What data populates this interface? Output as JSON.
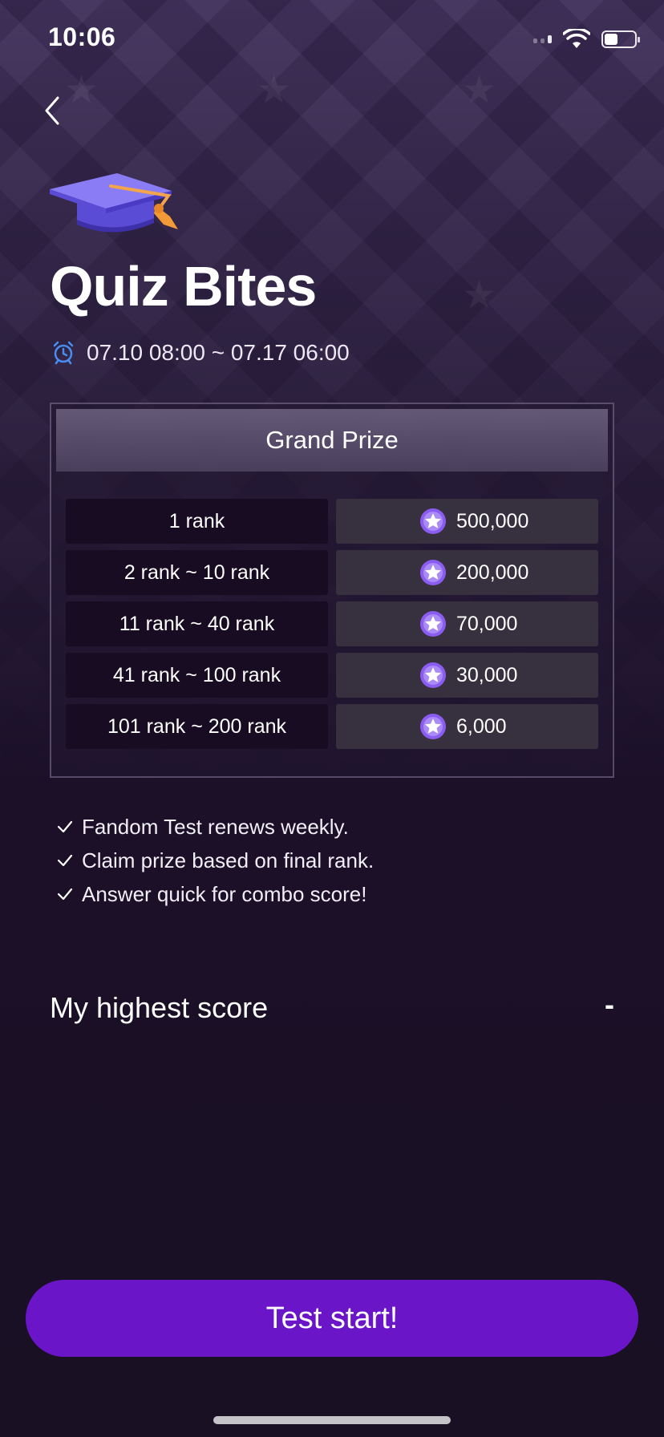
{
  "status_bar": {
    "time": "10:06",
    "battery_level": 0.45
  },
  "header": {
    "back_icon": "chevron-left-icon"
  },
  "quiz": {
    "title": "Quiz Bites",
    "period": "07.10 08:00 ~ 07.17 06:00",
    "period_icon": "alarm-clock-icon",
    "hero_icon": "graduation-cap-icon"
  },
  "prize": {
    "header": "Grand Prize",
    "coin_icon": "star-coin-icon",
    "rows": [
      {
        "rank": "1 rank",
        "reward": "500,000"
      },
      {
        "rank": "2 rank ~  10 rank",
        "reward": "200,000"
      },
      {
        "rank": "11 rank ~  40 rank",
        "reward": "70,000"
      },
      {
        "rank": "41 rank ~  100 rank",
        "reward": "30,000"
      },
      {
        "rank": "101 rank ~  200 rank",
        "reward": "6,000"
      }
    ]
  },
  "notes": [
    "Fandom Test renews weekly.",
    "Claim prize based on final rank.",
    "Answer quick for combo score!"
  ],
  "score": {
    "label": "My highest score",
    "value": "-"
  },
  "cta": {
    "label": "Test start!"
  },
  "colors": {
    "accent": "#6b15c8",
    "clock": "#4a8cf0",
    "coin": "#8a5cf0"
  }
}
